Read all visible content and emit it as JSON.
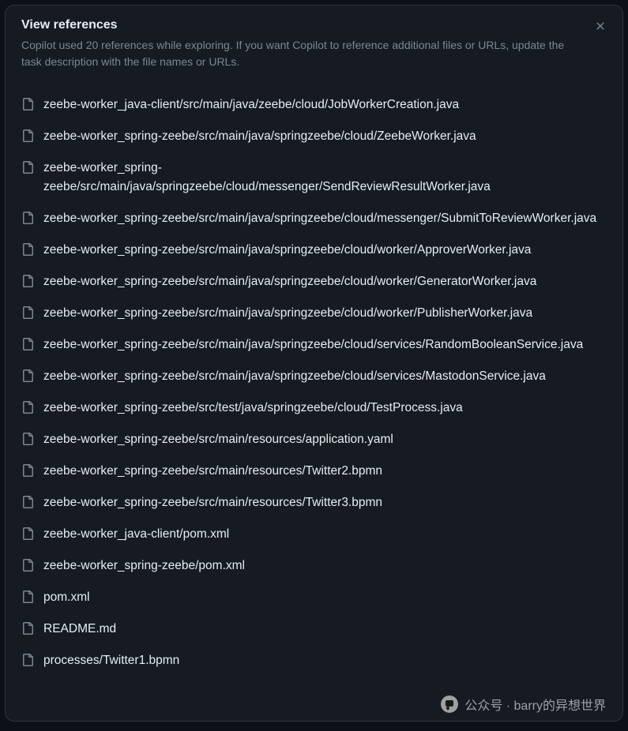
{
  "dialog": {
    "title": "View references",
    "subtitle": "Copilot used 20 references while exploring. If you want Copilot to reference additional files or URLs, update the task description with the file names or URLs."
  },
  "files": [
    {
      "path": "zeebe-worker_java-client/src/main/java/zeebe/cloud/JobWorkerCreation.java"
    },
    {
      "path": "zeebe-worker_spring-zeebe/src/main/java/springzeebe/cloud/ZeebeWorker.java"
    },
    {
      "path": "zeebe-worker_spring-zeebe/src/main/java/springzeebe/cloud/messenger/SendReviewResultWorker.java"
    },
    {
      "path": "zeebe-worker_spring-zeebe/src/main/java/springzeebe/cloud/messenger/SubmitToReviewWorker.java"
    },
    {
      "path": "zeebe-worker_spring-zeebe/src/main/java/springzeebe/cloud/worker/ApproverWorker.java"
    },
    {
      "path": "zeebe-worker_spring-zeebe/src/main/java/springzeebe/cloud/worker/GeneratorWorker.java"
    },
    {
      "path": "zeebe-worker_spring-zeebe/src/main/java/springzeebe/cloud/worker/PublisherWorker.java"
    },
    {
      "path": "zeebe-worker_spring-zeebe/src/main/java/springzeebe/cloud/services/RandomBooleanService.java"
    },
    {
      "path": "zeebe-worker_spring-zeebe/src/main/java/springzeebe/cloud/services/MastodonService.java"
    },
    {
      "path": "zeebe-worker_spring-zeebe/src/test/java/springzeebe/cloud/TestProcess.java"
    },
    {
      "path": "zeebe-worker_spring-zeebe/src/main/resources/application.yaml"
    },
    {
      "path": "zeebe-worker_spring-zeebe/src/main/resources/Twitter2.bpmn"
    },
    {
      "path": "zeebe-worker_spring-zeebe/src/main/resources/Twitter3.bpmn"
    },
    {
      "path": "zeebe-worker_java-client/pom.xml"
    },
    {
      "path": "zeebe-worker_spring-zeebe/pom.xml"
    },
    {
      "path": "pom.xml"
    },
    {
      "path": "README.md"
    },
    {
      "path": "processes/Twitter1.bpmn"
    }
  ],
  "watermark": {
    "text": "公众号 · barry的异想世界"
  }
}
